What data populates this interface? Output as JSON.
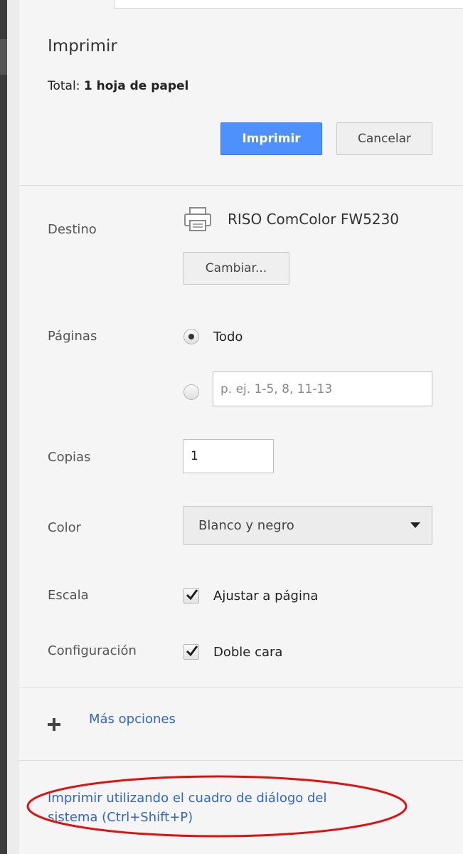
{
  "dialog": {
    "title": "Imprimir",
    "summary_prefix": "Total: ",
    "summary_value": "1 hoja de papel",
    "print_button": "Imprimir",
    "cancel_button": "Cancelar"
  },
  "destination": {
    "label": "Destino",
    "printer_name": "RISO ComColor FW5230",
    "change_button": "Cambiar..."
  },
  "pages": {
    "label": "Páginas",
    "option_all": "Todo",
    "selected": "all",
    "custom_placeholder": "p. ej. 1-5, 8, 11-13"
  },
  "copies": {
    "label": "Copias",
    "value": "1"
  },
  "color": {
    "label": "Color",
    "selected": "Blanco y negro"
  },
  "scale": {
    "label": "Escala",
    "option": "Ajustar a página",
    "checked": true
  },
  "settings": {
    "label": "Configuración",
    "option": "Doble cara",
    "checked": true
  },
  "more_options": {
    "label": "Más opciones",
    "icon": "plus-icon"
  },
  "system_dialog": {
    "line1": "Imprimir utilizando el cuadro de diálogo del",
    "line2": "sistema (Ctrl+Shift+P)"
  },
  "colors": {
    "primary_button": "#4d90fe",
    "link": "#3366cc",
    "annotation_ellipse": "#e01010"
  }
}
